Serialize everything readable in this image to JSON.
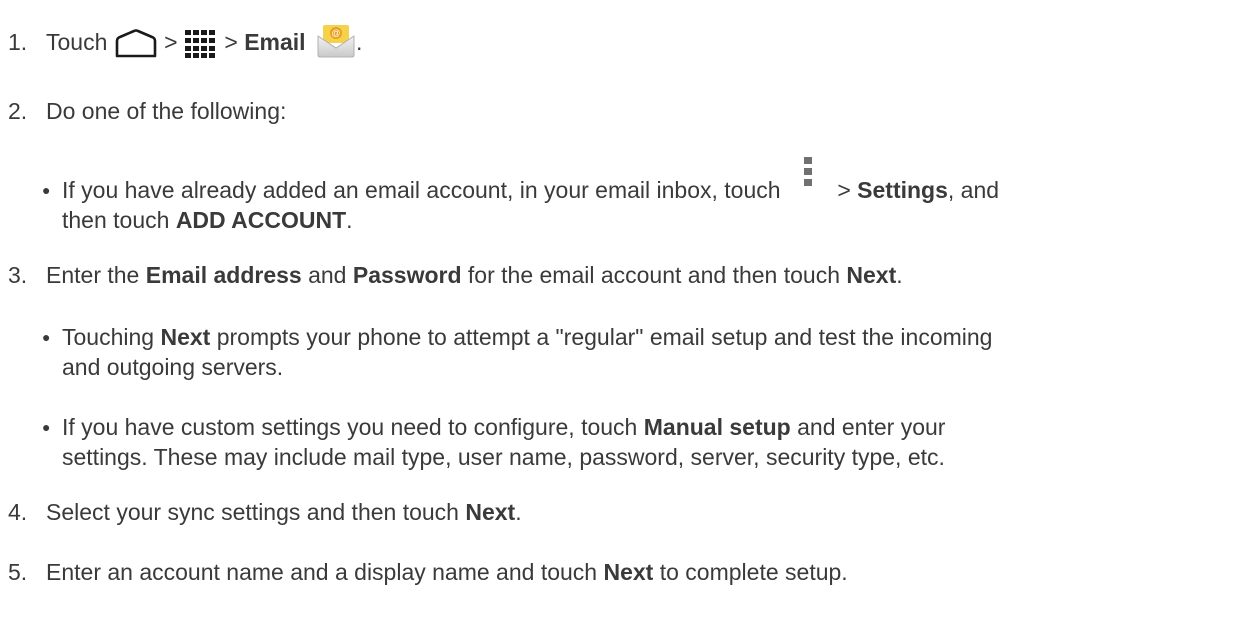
{
  "steps": {
    "s1": {
      "num": "1.",
      "pre": "Touch",
      "sep1": ">",
      "sep2": ">",
      "bold": "Email",
      "post": ".",
      "icons": [
        "home-icon",
        "apps-grid-icon",
        "email-app-icon"
      ]
    },
    "s2": {
      "num": "2.",
      "text": "Do one of the following:"
    },
    "s2b1": {
      "t1": "If you have already added an email account, in your email inbox, touch",
      "sep": ">",
      "b1": "Settings",
      "t2": ", and",
      "t3": "then touch",
      "b2": "ADD ACCOUNT",
      "t4": ".",
      "icon": "menu-more-icon"
    },
    "s3": {
      "num": "3.",
      "t1": "Enter the",
      "b1": "Email address",
      "t2": "and",
      "b2": "Password",
      "t3": "for the email account and then touch",
      "b3": "Next",
      "t4": "."
    },
    "s3b1": {
      "t1": "Touching",
      "b1": "Next",
      "t2": "prompts your phone to attempt a \"regular\" email setup and test the incoming",
      "t3": "and outgoing servers."
    },
    "s3b2": {
      "t1": "If you have custom settings you need to configure, touch",
      "b1": "Manual setup",
      "t2": "and enter your",
      "t3": "settings. These may include mail type, user name, password, server, security type, etc."
    },
    "s4": {
      "num": "4.",
      "t1": "Select your sync settings and then touch",
      "b1": "Next",
      "t2": "."
    },
    "s5": {
      "num": "5.",
      "t1": "Enter an account name and a display name and touch",
      "b1": "Next",
      "t2": "to complete setup."
    }
  }
}
